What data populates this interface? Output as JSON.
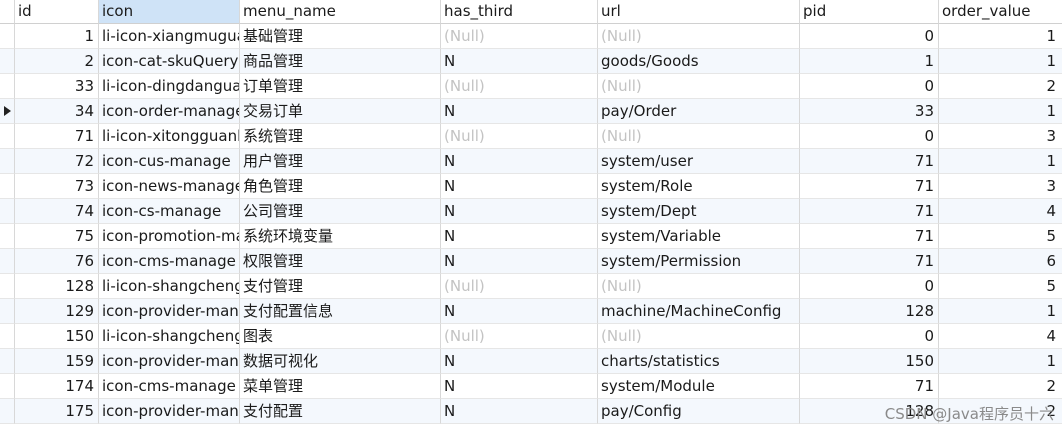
{
  "columns": [
    "id",
    "icon",
    "menu_name",
    "has_third",
    "url",
    "pid",
    "order_value"
  ],
  "rows": [
    {
      "id": "1",
      "icon": "li-icon-xiangmuguanli",
      "menu_name": "基础管理",
      "has_third": "(Null)",
      "url": "(Null)",
      "pid": "0",
      "order_value": "1"
    },
    {
      "id": "2",
      "icon": "icon-cat-skuQuery",
      "menu_name": "商品管理",
      "has_third": "N",
      "url": "goods/Goods",
      "pid": "1",
      "order_value": "1"
    },
    {
      "id": "33",
      "icon": "li-icon-dingdanguanli",
      "menu_name": "订单管理",
      "has_third": "(Null)",
      "url": "(Null)",
      "pid": "0",
      "order_value": "2"
    },
    {
      "id": "34",
      "icon": "icon-order-manage",
      "menu_name": "交易订单",
      "has_third": "N",
      "url": "pay/Order",
      "pid": "33",
      "order_value": "1"
    },
    {
      "id": "71",
      "icon": "li-icon-xitongguanli",
      "menu_name": "系统管理",
      "has_third": "(Null)",
      "url": "(Null)",
      "pid": "0",
      "order_value": "3"
    },
    {
      "id": "72",
      "icon": "icon-cus-manage",
      "menu_name": "用户管理",
      "has_third": "N",
      "url": "system/user",
      "pid": "71",
      "order_value": "1"
    },
    {
      "id": "73",
      "icon": "icon-news-manage",
      "menu_name": "角色管理",
      "has_third": "N",
      "url": "system/Role",
      "pid": "71",
      "order_value": "3"
    },
    {
      "id": "74",
      "icon": "icon-cs-manage",
      "menu_name": "公司管理",
      "has_third": "N",
      "url": "system/Dept",
      "pid": "71",
      "order_value": "4"
    },
    {
      "id": "75",
      "icon": "icon-promotion-manage",
      "menu_name": "系统环境变量",
      "has_third": "N",
      "url": "system/Variable",
      "pid": "71",
      "order_value": "5"
    },
    {
      "id": "76",
      "icon": "icon-cms-manage",
      "menu_name": "权限管理",
      "has_third": "N",
      "url": "system/Permission",
      "pid": "71",
      "order_value": "6"
    },
    {
      "id": "128",
      "icon": "li-icon-shangchengxitong",
      "menu_name": "支付管理",
      "has_third": "(Null)",
      "url": "(Null)",
      "pid": "0",
      "order_value": "5"
    },
    {
      "id": "129",
      "icon": "icon-provider-manage",
      "menu_name": "支付配置信息",
      "has_third": "N",
      "url": "machine/MachineConfig",
      "pid": "128",
      "order_value": "1"
    },
    {
      "id": "150",
      "icon": "li-icon-shangchengxitong",
      "menu_name": "图表",
      "has_third": "(Null)",
      "url": "(Null)",
      "pid": "0",
      "order_value": "4"
    },
    {
      "id": "159",
      "icon": "icon-provider-manage",
      "menu_name": "数据可视化",
      "has_third": "N",
      "url": "charts/statistics",
      "pid": "150",
      "order_value": "1"
    },
    {
      "id": "174",
      "icon": "icon-cms-manage",
      "menu_name": "菜单管理",
      "has_third": "N",
      "url": "system/Module",
      "pid": "71",
      "order_value": "2"
    },
    {
      "id": "175",
      "icon": "icon-provider-manage",
      "menu_name": "支付配置",
      "has_third": "N",
      "url": "pay/Config",
      "pid": "128",
      "order_value": "2"
    }
  ],
  "selected_column": "icon",
  "current_row_index": 3,
  "null_text": "(Null)",
  "watermark": "CSDN @Java程序员十六",
  "colors": {
    "header_selected": "#cfe3f7",
    "row_alt": "#f4f8fd",
    "null_text": "#c3c3c3",
    "grid_line": "#d8d8d8"
  }
}
